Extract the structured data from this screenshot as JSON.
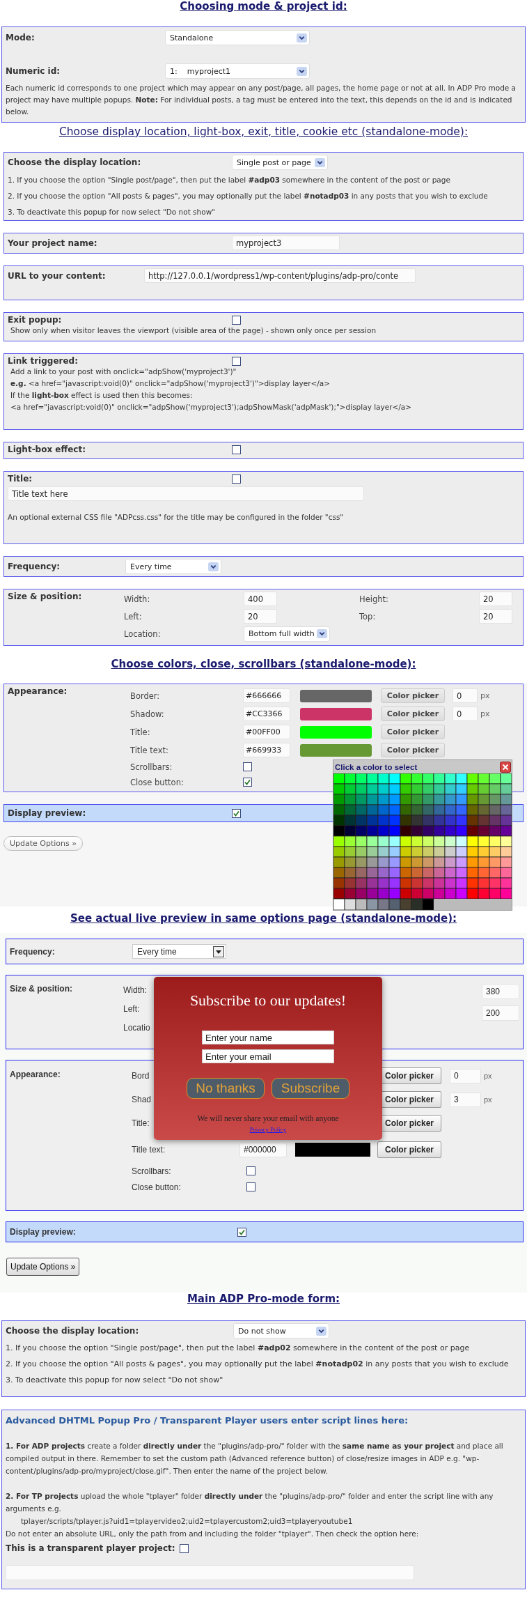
{
  "mode_section": {
    "heading": "Choosing mode & project id:",
    "mode": {
      "label": "Mode:",
      "value": "Standalone"
    },
    "numeric_id": {
      "label": "Numeric id:",
      "value": "1:    myproject1"
    },
    "note": "Each numeric id corresponds to one project which may appear on any post/page, all pages, the home page or not at all. In ADP Pro mode a project may have multiple popups. **Note:** For individual posts, a tag must be entered into the text, this depends on the id and is indicated below."
  },
  "display_section": {
    "heading": "Choose display location, light-box, exit, title, cookie etc (standalone-mode):",
    "location": {
      "label": "Choose the display location:",
      "value": "Single post or page",
      "lines": [
        "1. If you choose the option \"Single post/page\", then put the label **#adp03** somewhere in the content of the post or page",
        "2. If you choose the option \"All posts & pages\", you may optionally put the label **#notadp03** in any posts that you wish to exclude",
        "3. To deactivate this popup for now select \"Do not show\""
      ]
    },
    "project_name": {
      "label": "Your project name:",
      "value": "myproject3"
    },
    "url": {
      "label": "URL to your content:",
      "value": "http://127.0.0.1/wordpress1/wp-content/plugins/adp-pro/conte"
    },
    "exit_popup": {
      "label": "Exit popup:",
      "checked": false,
      "note": "Show only when visitor leaves the viewport (visible area of the page) - shown only once per session"
    },
    "link_triggered": {
      "label": "Link triggered:",
      "checked": false,
      "lines": [
        "Add a link to your post with onclick=\"adpShow('myproject3')\"",
        "**e.g.** <a href=\"javascript:void(0)\" onclick=\"adpShow('myproject3')\">display layer</a>",
        "If the **light-box** effect is used then this becomes:",
        "<a href=\"javascript:void(0)\" onclick=\"adpShow('myproject3');adpShowMask('adpMask');\">display layer</a>"
      ]
    },
    "light_box": {
      "label": "Light-box effect:",
      "checked": false
    },
    "title": {
      "label": "Title:",
      "checked": false,
      "value": "Title text here",
      "note": "An optional external CSS file \"ADPcss.css\" for the title may be configured in the folder \"css\""
    },
    "frequency": {
      "label": "Frequency:",
      "value": "Every time"
    },
    "size_position": {
      "label": "Size & position:",
      "rows": [
        {
          "label": "Width:",
          "value": "400",
          "label_2": "Height:",
          "value_2": "20"
        },
        {
          "label": "Left:",
          "value": "20",
          "label_2": "Top:",
          "value_2": "20"
        },
        {
          "label": "Location:",
          "select": "Bottom full width"
        }
      ]
    }
  },
  "colors_section": {
    "heading": "Choose colors, close, scrollbars (standalone-mode):",
    "appearance": {
      "label": "Appearance:",
      "colors": [
        {
          "label": "Border:",
          "value": "#666666",
          "color": "#666666",
          "button": "Color picker",
          "px": "0",
          "unit": "px"
        },
        {
          "label": "Shadow:",
          "value": "#CC3366",
          "color": "#cc3366",
          "button": "Color picker",
          "px": "0",
          "unit": "px"
        },
        {
          "label": "Title:",
          "value": "#00FF00",
          "color": "#00ff00",
          "button": "Color picker"
        },
        {
          "label": "Title text:",
          "value": "#669933",
          "color": "#669933",
          "button": "Color picker"
        }
      ],
      "checks": [
        {
          "label": "Scrollbars:",
          "checked": false
        },
        {
          "label": "Close button:",
          "checked": true
        }
      ]
    },
    "display_preview": {
      "label": "Display preview:",
      "checked": true
    },
    "update_button": "Update Options »"
  },
  "color_picker": {
    "title": "Click a color to select"
  },
  "live_preview": {
    "heading": "See actual live preview in same options page (standalone-mode):",
    "frequency": {
      "label": "Frequency:",
      "value": "Every time"
    },
    "size_position": {
      "label": "Size & position:",
      "labels": [
        "Width:",
        "Left:",
        "Locatio"
      ],
      "values": [
        "380",
        "200"
      ]
    },
    "appearance": {
      "label": "Appearance:",
      "rows": [
        {
          "label": "Bord",
          "button": "Color picker",
          "px": "0",
          "unit": "px"
        },
        {
          "label": "Shad",
          "button": "Color picker",
          "px": "3",
          "unit": "px"
        },
        {
          "label": "Title:",
          "button": "Color picker"
        },
        {
          "label": "Title text:",
          "value": "#000000",
          "color": "#000000",
          "button": "Color picker"
        }
      ],
      "checks": [
        {
          "label": "Scrollbars:",
          "checked": false
        },
        {
          "label": "Close button:",
          "checked": false
        }
      ]
    },
    "display_preview": {
      "label": "Display preview:",
      "checked": true
    },
    "update_button": "Update Options »"
  },
  "subscribe_popup": {
    "title": "Subscribe to our updates!",
    "name_placeholder": "Enter your name",
    "email_placeholder": "Enter your email",
    "buttons": [
      "No thanks",
      "Subscribe"
    ],
    "note": "We will never share your email with anyone",
    "link": "Privacy Policy"
  },
  "main_form": {
    "heading": "Main ADP Pro-mode form:",
    "location": {
      "label": "Choose the display location:",
      "value": "Do not show",
      "lines": [
        "1. If you choose the option \"Single post/page\", then put the label **#adp02** somewhere in the content of the post or page",
        "2. If you choose the option \"All posts & pages\", you may optionally put the label **#notadp02** in any posts that you wish to exclude",
        "3. To deactivate this popup for now select \"Do not show\""
      ]
    }
  },
  "advanced": {
    "heading": "Advanced DHTML Popup Pro / Transparent Player users enter script lines here:",
    "paragraphs": [
      "**1. For ADP projects** create a folder **directly under** the \"plugins/adp-pro/\" folder with the **same name as your project** and place all compiled output in there. Remember to set the custom path (Advanced reference button) of close/resize images in ADP e.g. \"wp-content/plugins/adp-pro/myproject/close.gif\". Then enter the name of the project below.",
      "**2. For TP projects** upload the whole \"tplayer\" folder **directly under** the \"plugins/adp-pro/\" folder and enter the script line with any arguments e.g."
    ],
    "script_example": "tplayer/scripts/tplayer.js?uid1=tplayervideo2;uid2=tplayercustom2;uid3=tplayeryoutube1",
    "hint": "Do not enter an absolute URL, only the path from and including the folder \"tplayer\". Then check the option here:",
    "transparent": {
      "label": "This is a transparent player project:",
      "checked": false
    }
  }
}
